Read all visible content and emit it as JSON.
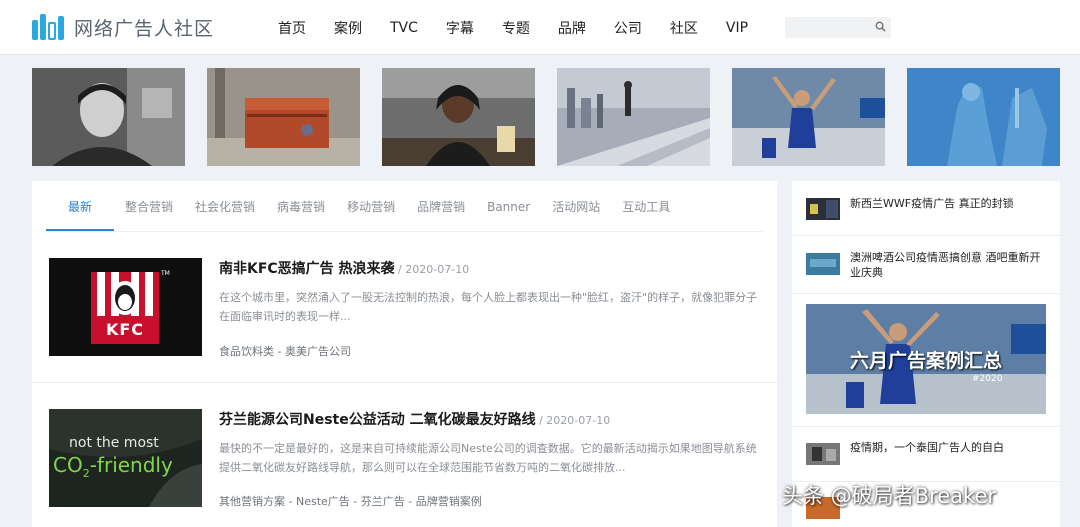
{
  "header": {
    "logo_text": "网络广告人社区",
    "nav": [
      "首页",
      "案例",
      "TVC",
      "字幕",
      "专题",
      "品牌",
      "公司",
      "社区",
      "VIP"
    ],
    "search_placeholder": ""
  },
  "tabs": [
    "最新",
    "整合营销",
    "社会化营销",
    "病毒营销",
    "移动营销",
    "品牌营销",
    "Banner",
    "活动网站",
    "互动工具"
  ],
  "articles": [
    {
      "title": "南非KFC恶搞广告 热浪来袭",
      "date": " / 2020-07-10",
      "desc": "在这个城市里，突然涌入了一股无法控制的热浪，每个人脸上都表现出一种\"脸红，盗汗\"的样子，就像犯罪分子在面临审讯时的表现一样...",
      "tags": "食品饮料类  - 奥美广告公司",
      "thumb_kfc": "KFC",
      "thumb_tm": "TM"
    },
    {
      "title": "芬兰能源公司Neste公益活动 二氧化碳最友好路线",
      "date": " / 2020-07-10",
      "desc": "最快的不一定是最好的，这是来自可持续能源公司Neste公司的调查数据。它的最新活动揭示如果地图导航系统提供二氧化碳友好路线导航，那么则可以在全球范围能节省数万吨的二氧化碳排放...",
      "tags": "其他营销方案 - Neste广告 - 芬兰广告 - 品牌营销案例",
      "thumb_line1": "not the most",
      "thumb_line2": "CO",
      "thumb_sub": "2",
      "thumb_line3": "-friendly"
    }
  ],
  "sidebar": {
    "items": [
      {
        "text": "新西兰WWF疫情广告 真正的封锁"
      },
      {
        "text": "澳洲啤酒公司疫情恶搞创意 酒吧重新开业庆典"
      },
      {
        "text": "疫情期，一个泰国广告人的自白"
      }
    ],
    "feature_title": "六月广告案例汇总",
    "feature_sub": "#2020"
  },
  "watermark": "头条 @破局者Breaker",
  "colors": {
    "accent": "#2a86d8",
    "logo": "#2aa9e0"
  }
}
